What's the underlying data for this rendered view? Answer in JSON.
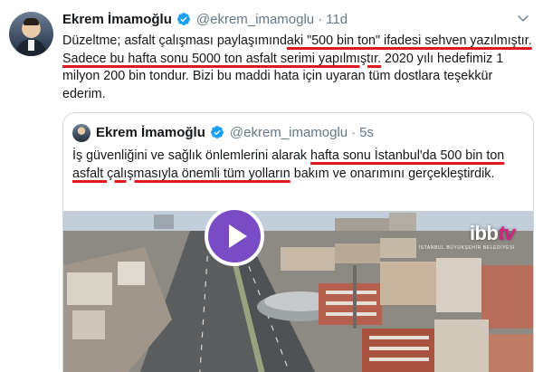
{
  "tweet": {
    "author_name": "Ekrem İmamoğlu",
    "author_handle": "@ekrem_imamoglu",
    "separator": "·",
    "time": "11d",
    "text_pre": "Düzeltme; asfalt çalışması paylaşımınd",
    "text_ul1": "aki \"500 bin ton\" ifadesi sehven yazılmıştır. Sadece bu hafta sonu 5000 ton asfalt serimi yapılmıştır.",
    "text_post": " 2020 yılı hedefimiz 1 milyon 200 bin tondur. Bizi bu maddi hata için uyaran tüm dostlara teşekkür ederim."
  },
  "quoted": {
    "author_name": "Ekrem İmamoğlu",
    "author_handle": "@ekrem_imamoglu",
    "separator": "·",
    "time": "5s",
    "text_pre": "İş güvenliğini ve sağlık önlemlerini alarak ",
    "text_ul1": "hafta sonu İstanbul'da 500 bin ton asfalt çalışmasıyla önemli tüm yolların",
    "text_post": " bakım ve onarımını gerçekleştirdik.",
    "media": {
      "logo_main": "ibb",
      "logo_tv": "tv",
      "logo_sub": "İSTANBUL BÜYÜKŞEHİR BELEDİYESİ"
    }
  },
  "icons": {
    "verified": "verified-badge-icon",
    "caret": "chevron-down-icon",
    "play": "play-icon"
  },
  "colors": {
    "verified_blue": "#1da1f2",
    "handle_gray": "#657786",
    "underline_red": "#e0191f",
    "play_purple": "#794bc4",
    "logo_pink": "#d3227f"
  }
}
